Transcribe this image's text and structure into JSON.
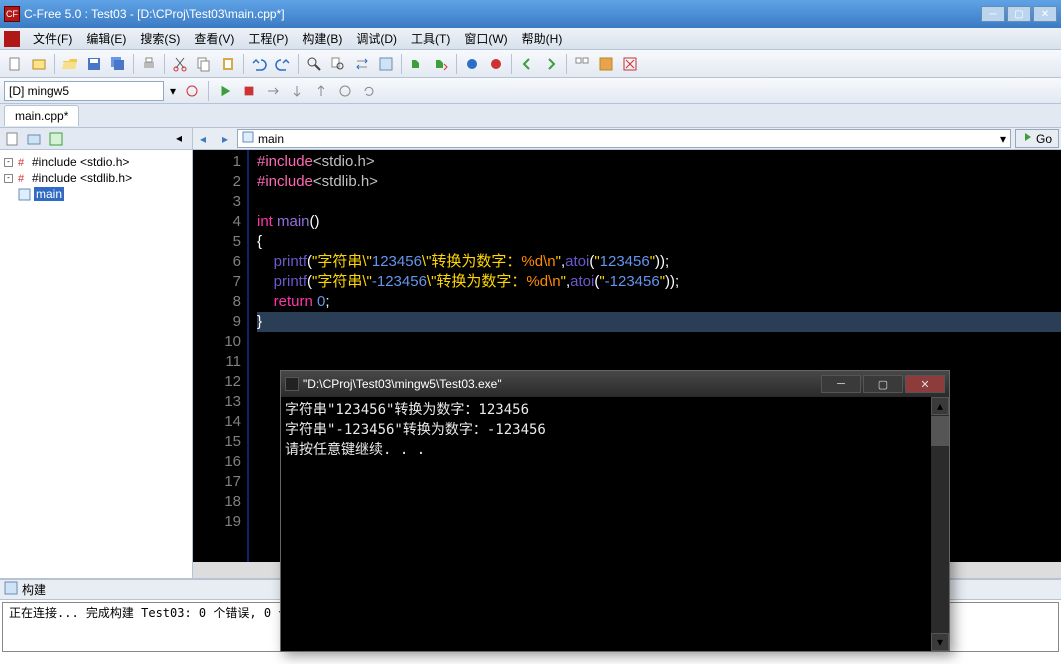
{
  "window": {
    "title": "C-Free 5.0 : Test03 - [D:\\CProj\\Test03\\main.cpp*]"
  },
  "menu": {
    "items": [
      "文件(F)",
      "编辑(E)",
      "搜索(S)",
      "查看(V)",
      "工程(P)",
      "构建(B)",
      "调试(D)",
      "工具(T)",
      "窗口(W)",
      "帮助(H)"
    ]
  },
  "compiler": {
    "selected": "[D] mingw5"
  },
  "tab": {
    "label": "main.cpp*"
  },
  "tree": {
    "items": [
      {
        "label": "#include <stdio.h>",
        "icon": "hash"
      },
      {
        "label": "#include <stdlib.h>",
        "icon": "hash"
      },
      {
        "label": "main",
        "icon": "fn",
        "selected": true
      }
    ]
  },
  "funcbar": {
    "label": "main"
  },
  "go": {
    "label": "Go"
  },
  "code": {
    "line_count": 19,
    "lines": [
      {
        "tokens": [
          {
            "t": "#include",
            "c": "kw-inc"
          },
          {
            "t": "<stdio.h>",
            "c": "hdr"
          }
        ]
      },
      {
        "tokens": [
          {
            "t": "#include",
            "c": "kw-inc"
          },
          {
            "t": "<stdlib.h>",
            "c": "hdr"
          }
        ]
      },
      {
        "tokens": []
      },
      {
        "tokens": [
          {
            "t": "int ",
            "c": "kw"
          },
          {
            "t": "main",
            "c": "fn"
          },
          {
            "t": "()",
            "c": ""
          }
        ]
      },
      {
        "tokens": [
          {
            "t": "{",
            "c": ""
          }
        ]
      },
      {
        "indent": 1,
        "tokens": [
          {
            "t": "printf",
            "c": "callfn"
          },
          {
            "t": "(",
            "c": ""
          },
          {
            "t": "\"字符串\\\"",
            "c": "str"
          },
          {
            "t": "123456",
            "c": "num"
          },
          {
            "t": "\\\"转换为数字：",
            "c": "str"
          },
          {
            "t": "%d\\n",
            "c": "fmt"
          },
          {
            "t": "\"",
            "c": "str"
          },
          {
            "t": ",",
            "c": ""
          },
          {
            "t": "atoi",
            "c": "callfn"
          },
          {
            "t": "(",
            "c": ""
          },
          {
            "t": "\"",
            "c": "str"
          },
          {
            "t": "123456",
            "c": "num"
          },
          {
            "t": "\"",
            "c": "str"
          },
          {
            "t": "));",
            "c": ""
          }
        ]
      },
      {
        "indent": 1,
        "tokens": [
          {
            "t": "printf",
            "c": "callfn"
          },
          {
            "t": "(",
            "c": ""
          },
          {
            "t": "\"字符串\\\"",
            "c": "str"
          },
          {
            "t": "-123456",
            "c": "num"
          },
          {
            "t": "\\\"转换为数字：",
            "c": "str"
          },
          {
            "t": "%d\\n",
            "c": "fmt"
          },
          {
            "t": "\"",
            "c": "str"
          },
          {
            "t": ",",
            "c": ""
          },
          {
            "t": "atoi",
            "c": "callfn"
          },
          {
            "t": "(",
            "c": ""
          },
          {
            "t": "\"",
            "c": "str"
          },
          {
            "t": "-123456",
            "c": "num"
          },
          {
            "t": "\"",
            "c": "str"
          },
          {
            "t": "));",
            "c": ""
          }
        ]
      },
      {
        "indent": 1,
        "tokens": [
          {
            "t": "return ",
            "c": "kw"
          },
          {
            "t": "0",
            "c": "num"
          },
          {
            "t": ";",
            "c": ""
          }
        ]
      },
      {
        "tokens": [
          {
            "t": "}",
            "c": ""
          }
        ],
        "caret": true
      }
    ]
  },
  "console": {
    "title": "\"D:\\CProj\\Test03\\mingw5\\Test03.exe\"",
    "lines": [
      "字符串\"123456\"转换为数字：123456",
      "字符串\"-123456\"转换为数字：-123456",
      "请按任意键继续. . ."
    ]
  },
  "output": {
    "header": "构建",
    "lines": [
      "正在连接...",
      "",
      "完成构建 Test03: 0 个错误, 0 个警告"
    ]
  }
}
